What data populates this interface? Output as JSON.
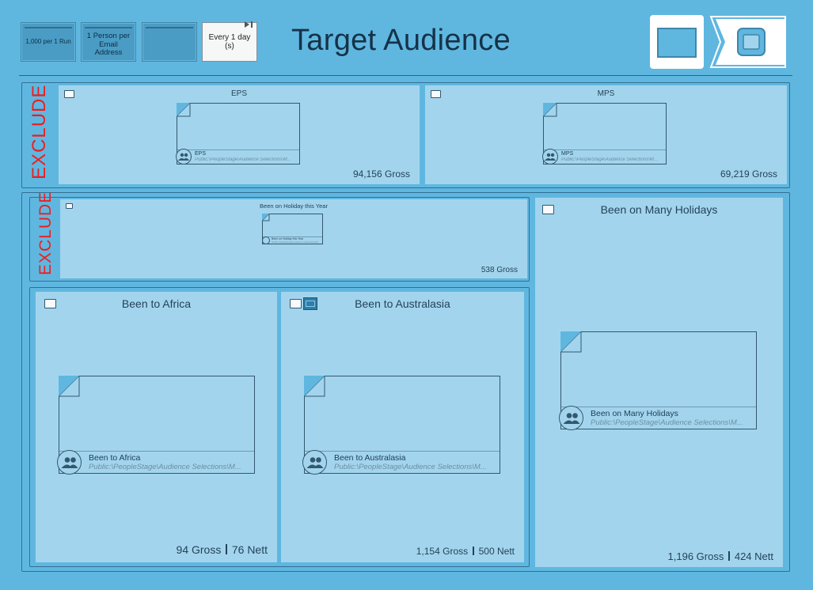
{
  "toolbar": {
    "limit_label": "1,000 per 1 Run",
    "dedupe_label": "1 Person per Email Address",
    "blank_label": "",
    "schedule_label": "Every 1 day (s)"
  },
  "header": {
    "title": "Target Audience"
  },
  "exclude_label": "EXCLUDE",
  "top_row": {
    "eps": {
      "title": "EPS",
      "card_name": "EPS",
      "card_path": "Public:\\PeopleStage\\Audience Selections\\M...",
      "gross": "94,156 Gross"
    },
    "mps": {
      "title": "MPS",
      "card_name": "MPS",
      "card_path": "Public:\\PeopleStage\\Audience Selections\\M...",
      "gross": "69,219 Gross"
    }
  },
  "holiday_year": {
    "title": "Been on Holiday this Year",
    "card_name": "Been on Holiday this Year",
    "card_path": "Public:\\PeopleStage\\Audience Selections\\M...",
    "gross": "538 Gross"
  },
  "africa": {
    "title": "Been to Africa",
    "card_name": "Been to Africa",
    "card_path": "Public:\\PeopleStage\\Audience Selections\\M...",
    "gross": "94 Gross",
    "nett": "76 Nett"
  },
  "australasia": {
    "title": "Been to Australasia",
    "card_name": "Been to Australasia",
    "card_path": "Public:\\PeopleStage\\Audience Selections\\M...",
    "gross": "1,154 Gross",
    "nett": "500 Nett"
  },
  "many_holidays": {
    "title": "Been on Many Holidays",
    "card_name": "Been on Many Holidays",
    "card_path": "Public:\\PeopleStage\\Audience Selections\\M...",
    "gross": "1,196 Gross",
    "nett": "424 Nett"
  },
  "icons": {
    "folder": "folder-icon",
    "audience": "people-icon",
    "output": "window-icon",
    "arrow": "next-arrow-icon"
  }
}
